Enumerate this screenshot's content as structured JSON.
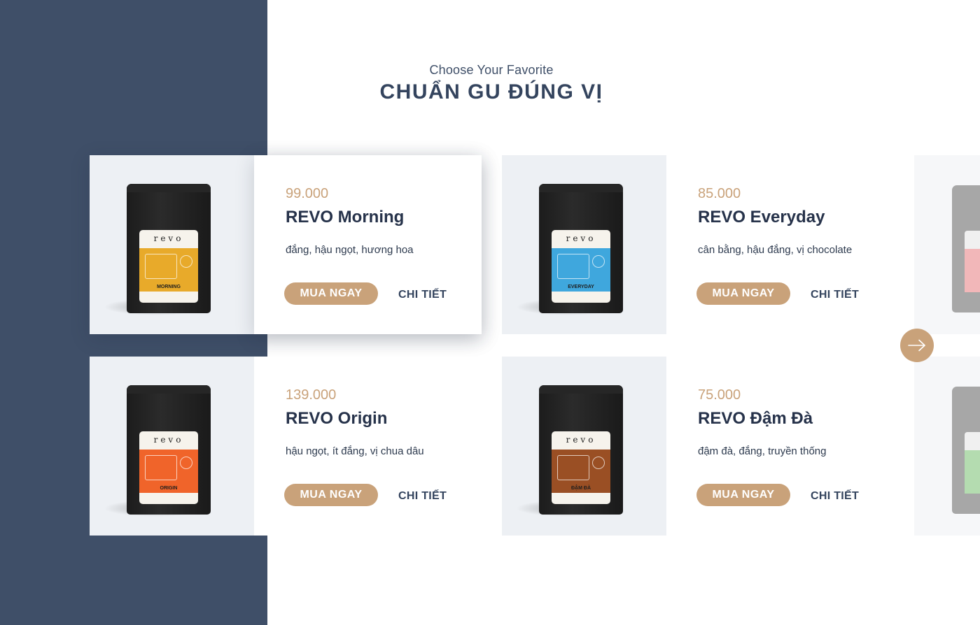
{
  "header": {
    "subtitle": "Choose Your Favorite",
    "title": "CHUẨN GU ĐÚNG VỊ"
  },
  "products": [
    {
      "price": "99.000",
      "name": "REVO Morning",
      "notes": "đắng, hậu ngọt, hương hoa",
      "buy_label": "MUA NGAY",
      "detail_label": "CHI TIẾT",
      "bag": {
        "brand": "revo",
        "label_name": "MORNING",
        "label_color": "#e8aa2a"
      }
    },
    {
      "price": "85.000",
      "name": "REVO Everyday",
      "notes": "cân bằng, hậu đắng, vị chocolate",
      "buy_label": "MUA NGAY",
      "detail_label": "CHI TIẾT",
      "bag": {
        "brand": "revo",
        "label_name": "EVERYDAY",
        "label_color": "#3fa7dd"
      }
    },
    {
      "price": "139.000",
      "name": "REVO Origin",
      "notes": "hậu ngọt, ít đắng, vị chua dâu",
      "buy_label": "MUA NGAY",
      "detail_label": "CHI TIẾT",
      "bag": {
        "brand": "revo",
        "label_name": "ORIGIN",
        "label_color": "#f0642a"
      }
    },
    {
      "price": "75.000",
      "name": "REVO Đậm Đà",
      "notes": "đậm đà, đắng, truyền thống",
      "buy_label": "MUA NGAY",
      "detail_label": "CHI TIẾT",
      "bag": {
        "brand": "revo",
        "label_name": "ĐẬM ĐÀ",
        "label_color": "#9a4f24"
      }
    }
  ],
  "peek_products": [
    {
      "label_color": "#f2b7b9"
    },
    {
      "label_color": "#b4dcb0"
    }
  ],
  "carousel": {
    "next_icon": "arrow-right-icon"
  },
  "colors": {
    "side_panel": "#3f4f68",
    "accent": "#c9a27a",
    "text_dark": "#26324a"
  }
}
